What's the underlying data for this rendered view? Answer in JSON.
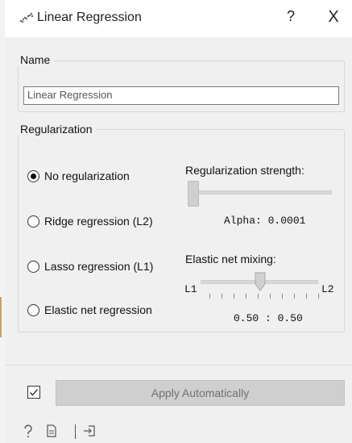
{
  "window": {
    "title": "Linear Regression",
    "help_glyph": "?",
    "close_glyph": "X",
    "icon": "scatter-plot-icon"
  },
  "name_section": {
    "label": "Name",
    "value": "Linear Regression"
  },
  "regularization": {
    "label": "Regularization",
    "options": [
      {
        "label": "No regularization",
        "selected": true
      },
      {
        "label": "Ridge regression (L2)",
        "selected": false
      },
      {
        "label": "Lasso regression (L1)",
        "selected": false
      },
      {
        "label": "Elastic net regression",
        "selected": false
      }
    ],
    "strength_label": "Regularization strength:",
    "strength_level": 0.0,
    "alpha_text": "Alpha: 0.0001",
    "mixing_label": "Elastic net mixing:",
    "mixing_left": "L1",
    "mixing_right": "L2",
    "mixing_level": 0.5,
    "mixing_ratio": "0.50 : 0.50"
  },
  "footer": {
    "auto_apply_checked": true,
    "apply_label": "Apply Automatically",
    "icons": [
      "help-icon",
      "report-icon",
      "output-icon"
    ]
  },
  "colors": {
    "window_bg": "#f0f0f0",
    "button_disabled_bg": "#cfcfcf",
    "button_disabled_text": "#6f6f6f"
  }
}
